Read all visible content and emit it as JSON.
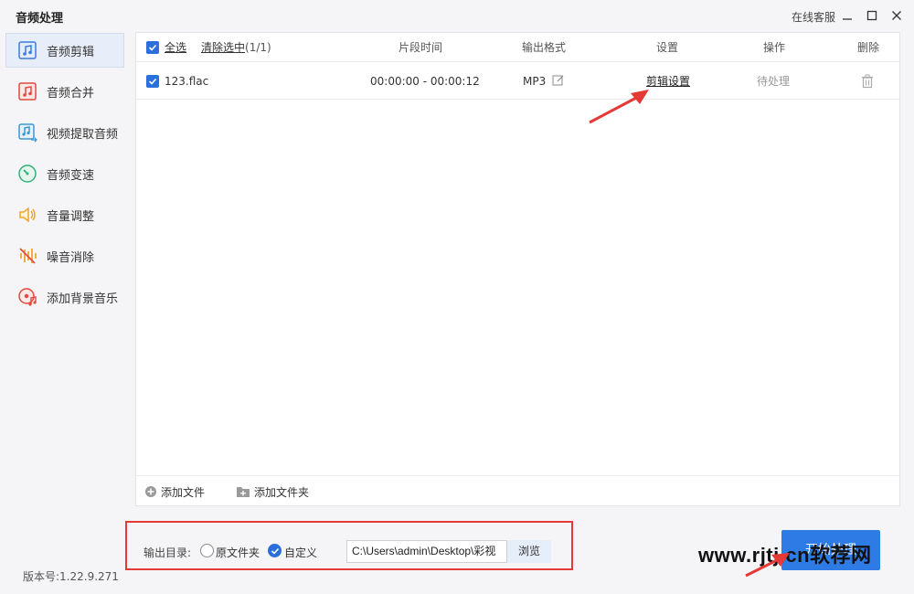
{
  "window": {
    "title": "音频处理",
    "support_label": "在线客服"
  },
  "sidebar": {
    "items": [
      {
        "label": "音频剪辑",
        "icon": "audio-cut-icon"
      },
      {
        "label": "音频合并",
        "icon": "audio-merge-icon"
      },
      {
        "label": "视频提取音频",
        "icon": "video-extract-audio-icon"
      },
      {
        "label": "音频变速",
        "icon": "speed-icon"
      },
      {
        "label": "音量调整",
        "icon": "volume-icon"
      },
      {
        "label": "噪音消除",
        "icon": "noise-reduction-icon"
      },
      {
        "label": "添加背景音乐",
        "icon": "background-music-icon"
      }
    ],
    "version": "版本号:1.22.9.271"
  },
  "table": {
    "select_all": "全选",
    "clear_selected": "清除选中",
    "selected_count": "(1/1)",
    "columns": [
      "片段时间",
      "输出格式",
      "设置",
      "操作",
      "删除"
    ],
    "rows": [
      {
        "filename": "123.flac",
        "segment_time": "00:00:00 - 00:00:12",
        "output_format": "MP3",
        "settings_link": "剪辑设置",
        "status": "待处理"
      }
    ]
  },
  "footer": {
    "add_file": "添加文件",
    "add_folder": "添加文件夹"
  },
  "output": {
    "label": "输出目录:",
    "option_original": "原文件夹",
    "option_custom": "自定义",
    "path": "C:\\Users\\admin\\Desktop\\彩视",
    "browse": "浏览"
  },
  "start_button": "开始处理",
  "watermark": {
    "latin": "www.rjtj.cn",
    "cn": "软荐网"
  },
  "colors": {
    "accent": "#2a6fdb",
    "annotation": "#e53935"
  }
}
